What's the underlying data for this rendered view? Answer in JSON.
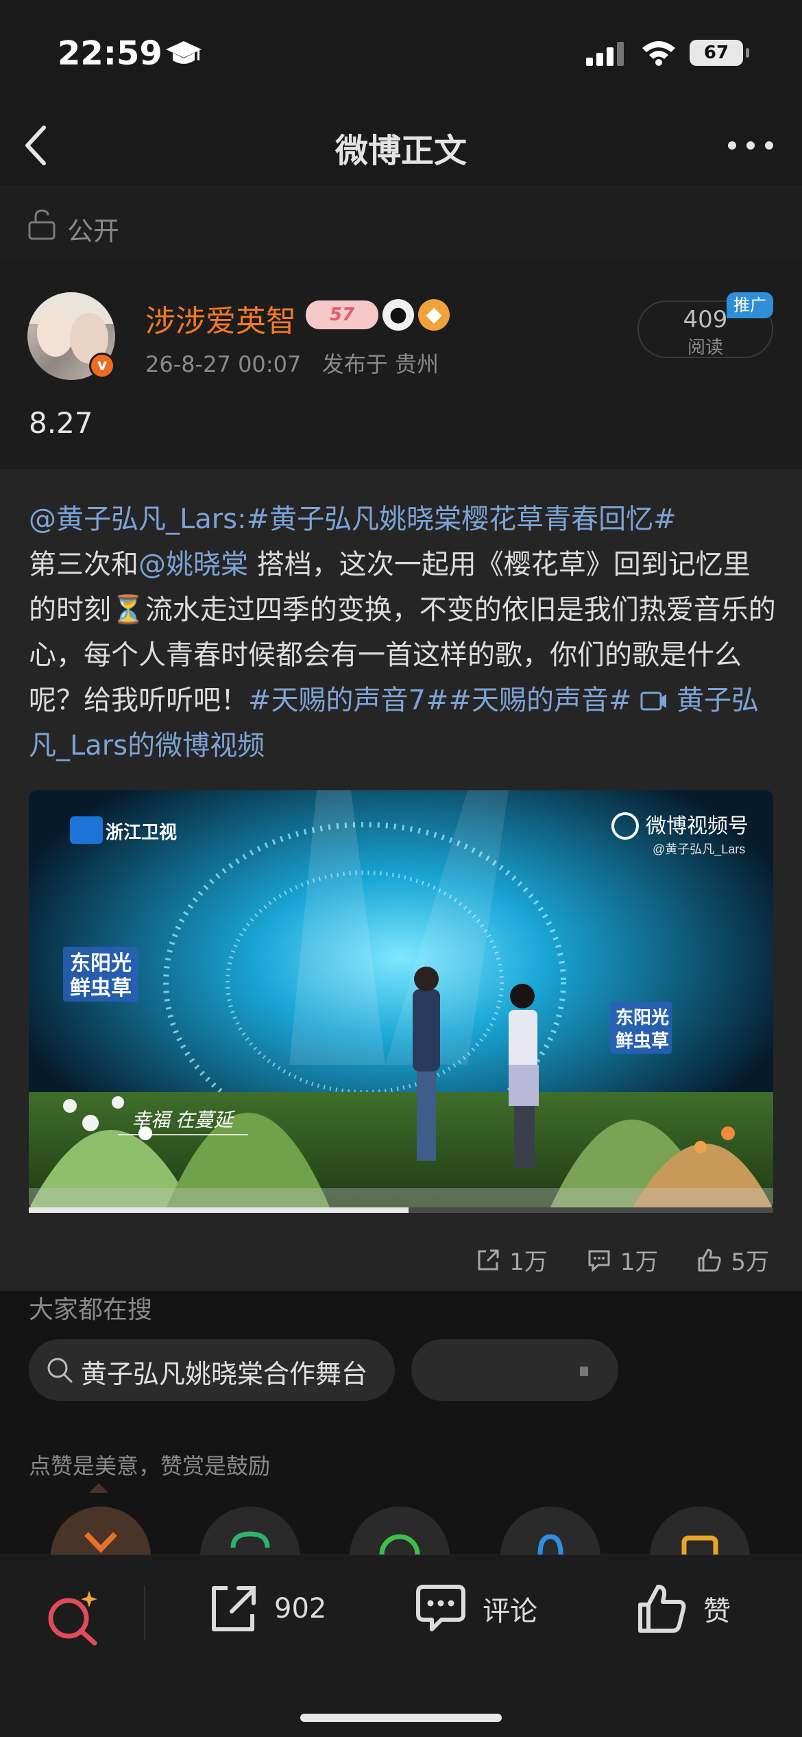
{
  "status_bar": {
    "time": "22:59",
    "battery": "67"
  },
  "header": {
    "title": "微博正文"
  },
  "visibility": {
    "label": "公开"
  },
  "post": {
    "author": "涉涉爱英智",
    "badge_57": "57",
    "date": "26-8-27 00:07",
    "location": "发布于 贵州",
    "reads_count": "409",
    "reads_label": "阅读",
    "promo": "推广",
    "text": "8.27"
  },
  "repost": {
    "mention_1": "@黄子弘凡_Lars",
    "colon": ":",
    "topic_1": "#黄子弘凡姚晓棠樱花草青春回忆#",
    "part_a": "第三次和",
    "mention_2": "@姚晓棠",
    "part_b": " 搭档，这次一起用《樱花草》回到记忆里的时刻",
    "part_c": "流水走过四季的变换，不变的依旧是我们热爱音乐的心，每个人青春时候都会有一首这样的歌，你们的歌是什么呢？给我听听吧！",
    "topic_2": "#天赐的声音7##天赐的声音#",
    "video_link": "黄子弘凡_Lars的微博视频",
    "video": {
      "channel_logo": "浙江卫视",
      "watermark": "微博视频号",
      "watermark_sub": "@黄子弘凡_Lars",
      "sponsor_left": "东阳光\n鲜虫草",
      "sponsor_right": "东阳光\n鲜虫草",
      "subtitle": "幸福  在蔓延",
      "progress": 0.51
    },
    "actions": {
      "share": "1万",
      "comment": "1万",
      "like": "5万"
    }
  },
  "search": {
    "title": "大家都在搜",
    "chip_1": "黄子弘凡姚晓棠合作舞台"
  },
  "reward": {
    "tip": "点赞是美意，赞赏是鼓励"
  },
  "toolbar": {
    "repost_count": "902",
    "comment_label": "评论",
    "like_label": "赞"
  },
  "colors": {
    "accent_orange": "#ef7a2a",
    "link_blue": "#7da3d6",
    "background": "#141414"
  }
}
